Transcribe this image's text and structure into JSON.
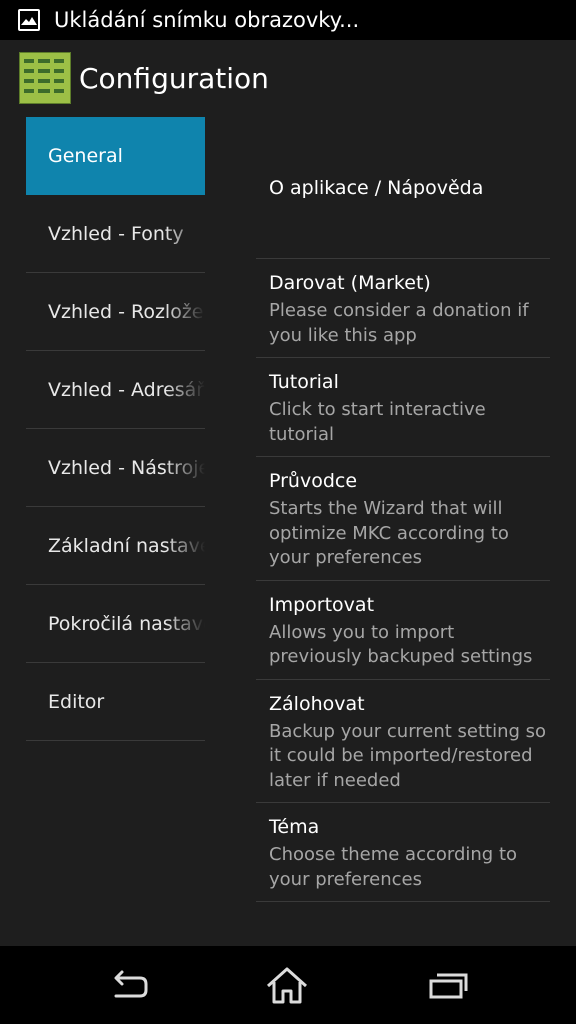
{
  "status_bar": {
    "icon": "image-icon",
    "text": "Ukládání snímku obrazovky..."
  },
  "action_bar": {
    "icon": "app-icon",
    "title": "Configuration"
  },
  "categories": [
    {
      "label": "General",
      "active": true
    },
    {
      "label": "Vzhled - Fonty",
      "active": false
    },
    {
      "label": "Vzhled - Rozložení",
      "active": false
    },
    {
      "label": "Vzhled - Adresář",
      "active": false
    },
    {
      "label": "Vzhled - Nástroje",
      "active": false
    },
    {
      "label": "Základní nastavení",
      "active": false
    },
    {
      "label": "Pokročilá nastavení",
      "active": false
    },
    {
      "label": "Editor",
      "active": false
    }
  ],
  "preferences": [
    {
      "title": "O aplikace / Nápověda",
      "summary": ""
    },
    {
      "title": "Darovat (Market)",
      "summary": "Please consider a donation if you like this app"
    },
    {
      "title": "Tutorial",
      "summary": "Click to start interactive tutorial"
    },
    {
      "title": "Průvodce",
      "summary": "Starts the Wizard that will optimize MKC according to your preferences"
    },
    {
      "title": "Importovat",
      "summary": "Allows you to import previously backuped settings"
    },
    {
      "title": "Zálohovat",
      "summary": "Backup your current setting so it could be imported/restored later if needed"
    },
    {
      "title": "Téma",
      "summary": "Choose theme according to your preferences"
    }
  ],
  "nav_bar": {
    "back_icon": "back-icon",
    "home_icon": "home-icon",
    "recents_icon": "recent-apps-icon"
  }
}
